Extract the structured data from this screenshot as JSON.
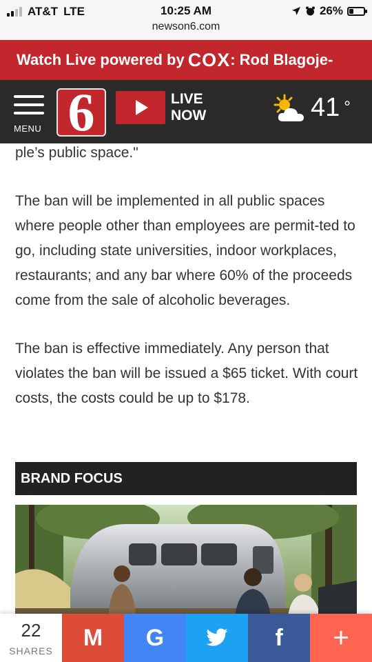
{
  "status_bar": {
    "carrier": "AT&T",
    "network": "LTE",
    "time": "10:25 AM",
    "url": "newson6.com",
    "battery": "26%",
    "battery_level": 0.26
  },
  "live_banner": {
    "prefix": "Watch Live powered by",
    "brand": "COX",
    "headline": ": Rod Blagoje-"
  },
  "header": {
    "menu_label": "MENU",
    "logo_text": "6",
    "live_line1": "LIVE",
    "live_line2": "NOW",
    "temperature": "41",
    "degree_symbol": "°",
    "weather_icon": "partly-cloudy-icon"
  },
  "article": {
    "paragraphs": [
      "ple’s public space.\"",
      "The ban will be implemented in all public spaces where people other than employees are permit-ted to go, including state universities, indoor workplaces, restaurants; and any bar where 60% of the proceeds come from the sale of alcoholic beverages.",
      "The ban is effective immediately. Any person that violates the ban will be issued a $65 ticket. With court costs, the costs could be up to $178."
    ]
  },
  "brand_focus": {
    "title": "BRAND FOCUS"
  },
  "share_bar": {
    "count": "22",
    "count_label": "SHARES",
    "buttons": [
      {
        "name": "gmail",
        "glyph": "M"
      },
      {
        "name": "google",
        "glyph": "G"
      },
      {
        "name": "twitter",
        "glyph": "twitter-bird-icon"
      },
      {
        "name": "facebook",
        "glyph": "f"
      },
      {
        "name": "more",
        "glyph": "+"
      }
    ]
  },
  "colors": {
    "brand_red": "#c1272d",
    "header_dark": "#2a2a2a",
    "gmail": "#dd4b39",
    "google": "#4285f4",
    "twitter": "#1da1f2",
    "facebook": "#3b5998",
    "more": "#ff6550"
  }
}
